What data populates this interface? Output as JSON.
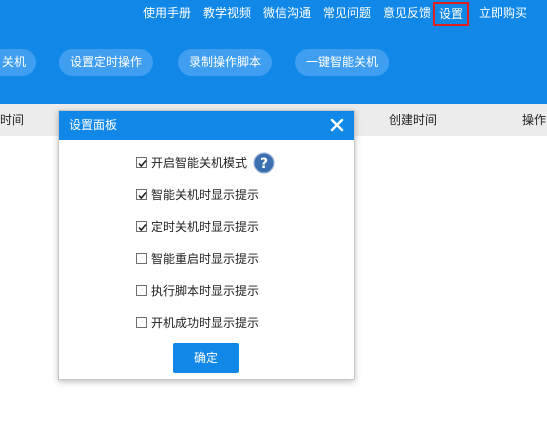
{
  "topnav": {
    "manual": "使用手册",
    "video": "教学视频",
    "wechat": "微信沟通",
    "faq": "常见问题",
    "feedback": "意见反馈",
    "settings": "设置",
    "buy": "立即购买"
  },
  "toolbar": {
    "btn1": "关机",
    "btn2": "设置定时操作",
    "btn3": "录制操作脚本",
    "btn4": "一键智能关机"
  },
  "table": {
    "col_time": "时间",
    "col_created": "创建时间",
    "col_action": "操作"
  },
  "dialog": {
    "title": "设置面板",
    "options": [
      {
        "label": "开启智能关机模式",
        "checked": true
      },
      {
        "label": "智能关机时显示提示",
        "checked": true
      },
      {
        "label": "定时关机时显示提示",
        "checked": true
      },
      {
        "label": "智能重启时显示提示",
        "checked": false
      },
      {
        "label": "执行脚本时显示提示",
        "checked": false
      },
      {
        "label": "开机成功时显示提示",
        "checked": false
      }
    ],
    "confirm": "确定"
  },
  "colors": {
    "primary": "#1188e8",
    "pill": "#3f9ef0",
    "highlight_border": "#e02020",
    "table_header_bg": "#ececec",
    "help_icon": "#3a6fb0"
  },
  "icons": {
    "close": "close-icon",
    "help": "question-mark-icon",
    "check": "checkmark-icon"
  }
}
